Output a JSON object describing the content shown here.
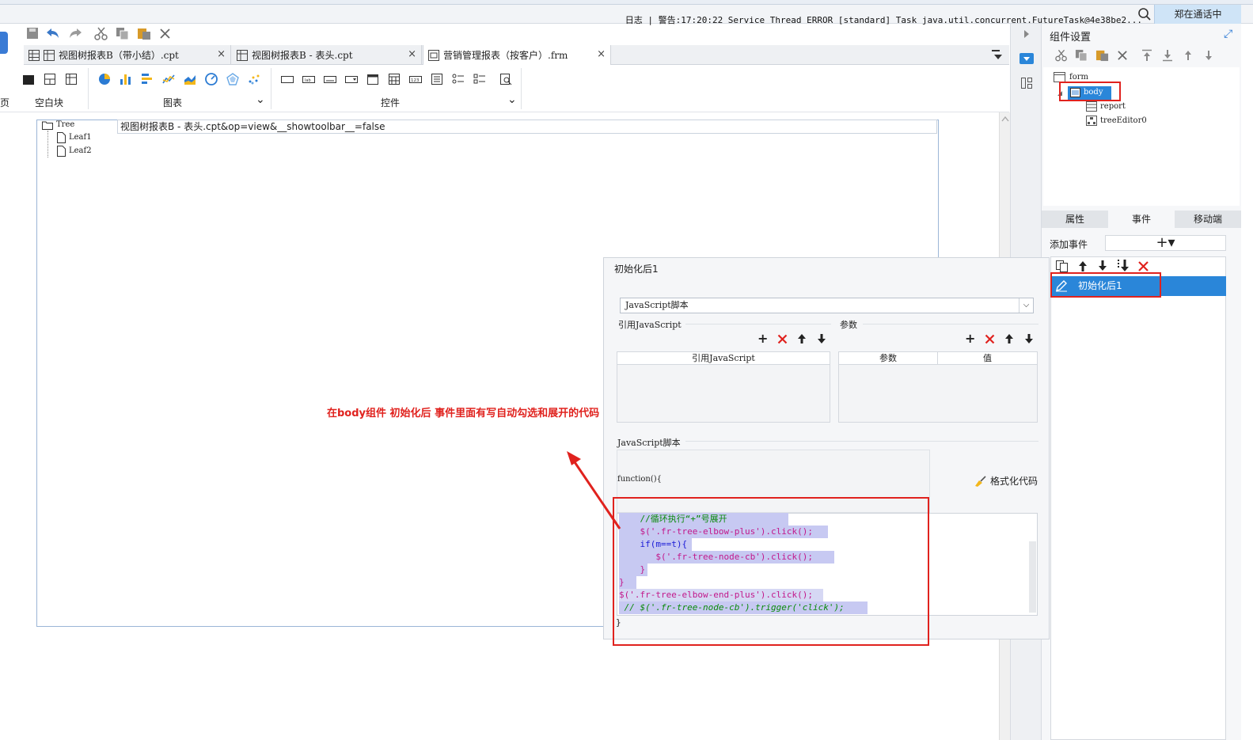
{
  "statusbar": {
    "log_text": "日志 | 警告:17:20:22 Service Thread ERROR [standard] Task java.util.concurrent.FutureTask@4e38be2...",
    "user": "郑在通话中"
  },
  "tabs": [
    {
      "label": "视图树报表B（带小结）.cpt",
      "close": "×"
    },
    {
      "label": "视图树报表B - 表头.cpt",
      "close": "×"
    },
    {
      "label": "营销管理报表（按客户）.frm",
      "close": "×"
    }
  ],
  "ribbon": {
    "group_blank": "空白块",
    "group_chart": "图表",
    "group_controls": "控件",
    "left_cut": "页",
    "chevron": "⌄"
  },
  "canvas": {
    "tree_root": "Tree",
    "tree_leaf1": "Leaf1",
    "tree_leaf2": "Leaf2",
    "url_value": "视图树报表B - 表头.cpt&op=view&__showtoolbar__=false"
  },
  "right_panel": {
    "title": "组件设置",
    "tree": {
      "form": "form",
      "body": "body",
      "report": "report",
      "tree_editor": "treeEditor0"
    },
    "tabs": [
      "属性",
      "事件",
      "移动端"
    ],
    "add_event_label": "添加事件",
    "add_event_btn": "+▾",
    "event_item": "初始化后1"
  },
  "dialog": {
    "title": "初始化后1",
    "select_value": "JavaScript脚本",
    "ref_js_label": "引用JavaScript",
    "params_label": "参数",
    "ref_js_col": "引用JavaScript",
    "param_col": "参数",
    "value_col": "值",
    "js_label": "JavaScript脚本",
    "function_open": "function(){",
    "format_btn": "格式化代码",
    "closing_brace": "}",
    "code_lines": [
      "    //循环执行“+”号展开",
      "    $('.fr-tree-elbow-plus').click();",
      "    if(m==t){",
      "       $('.fr-tree-node-cb').click();",
      "    }",
      "}",
      "$('.fr-tree-elbow-end-plus').click();",
      " // $('.fr-tree-node-cb').trigger('click');"
    ]
  },
  "annotation": {
    "text": "在body组件 初始化后 事件里面有写自动勾选和展开的代码"
  },
  "colors": {
    "accent": "#2a86d9",
    "annotation_red": "#e0221e",
    "code_highlight": "#c7c9f2"
  }
}
